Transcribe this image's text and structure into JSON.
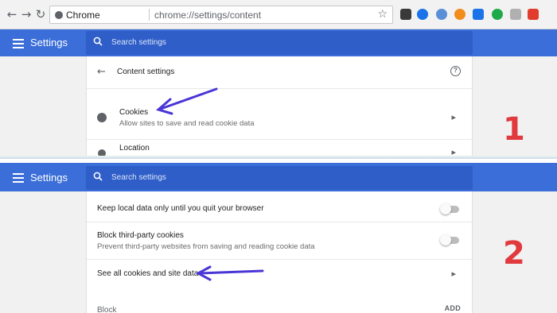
{
  "browser": {
    "site_label": "Chrome",
    "url": "chrome://settings/content",
    "extensions": [
      {
        "name": "m-ext-icon",
        "color": "#3a3a3a"
      },
      {
        "name": "q-ext-icon",
        "color": "#1a73e8"
      },
      {
        "name": "eye-ext-icon",
        "color": "#5a8fd8"
      },
      {
        "name": "b-ext-icon",
        "color": "#f28c1c"
      },
      {
        "name": "clip-ext-icon",
        "color": "#1a73e8"
      },
      {
        "name": "g-ext-icon",
        "color": "#1eaa4b"
      },
      {
        "name": "ie-ext-icon",
        "color": "#b0b0b0"
      },
      {
        "name": "h-ext-icon",
        "color": "#e23c2f"
      }
    ]
  },
  "header": {
    "title": "Settings",
    "search_placeholder": "Search settings"
  },
  "panel1": {
    "title": "Content settings",
    "cookies_label": "Cookies",
    "cookies_sub": "Allow sites to save and read cookie data",
    "location_label": "Location",
    "step": "1"
  },
  "panel2": {
    "keep_local_label": "Keep local data only until you quit your browser",
    "block_third_party_label": "Block third-party cookies",
    "block_third_party_sub": "Prevent third-party websites from saving and reading cookie data",
    "see_all_label": "See all cookies and site data",
    "block_label": "Block",
    "add_label": "ADD",
    "step": "2"
  },
  "colors": {
    "header_blue": "#3b6ed8",
    "search_blue": "#2f5ec8",
    "arrow_purple": "#4a36d6",
    "step_red": "#e0393e"
  }
}
